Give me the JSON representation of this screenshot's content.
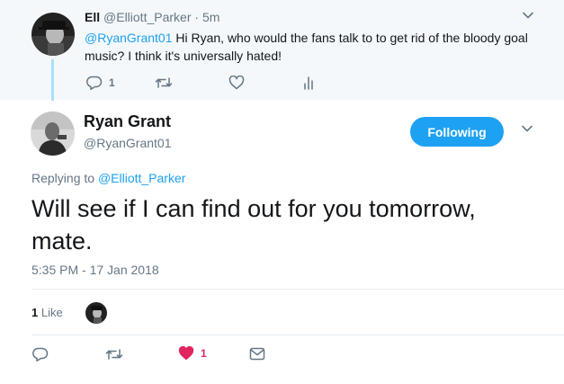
{
  "parent_tweet": {
    "name": "Ell",
    "handle": "@Elliott_Parker",
    "separator": "·",
    "time": "5m",
    "mention": "@RyanGrant01",
    "text": " Hi Ryan, who would the fans talk to to get rid of the bloody goal music? I think it's universally hated!",
    "reply_count": "1",
    "icons": [
      "reply-icon",
      "retweet-icon",
      "like-icon",
      "analytics-icon",
      "chevron-down-icon"
    ]
  },
  "main_tweet": {
    "name": "Ryan Grant",
    "handle": "@RyanGrant01",
    "follow_label": "Following",
    "replying_prefix": "Replying to ",
    "replying_to": "@Elliott_Parker",
    "text": "Will see if I can find out for you tomorrow, mate.",
    "timestamp": "5:35 PM - 17 Jan 2018",
    "likes_count": "1",
    "likes_label": " Like",
    "like_action_count": "1",
    "icons": [
      "reply-icon",
      "retweet-icon",
      "heart-filled-icon",
      "message-icon",
      "chevron-down-icon"
    ]
  },
  "colors": {
    "accent": "#1da1f2",
    "muted": "#657786",
    "like": "#e0245e",
    "thread_line": "#a6e0ff",
    "parent_bg": "#f5f8fa"
  }
}
